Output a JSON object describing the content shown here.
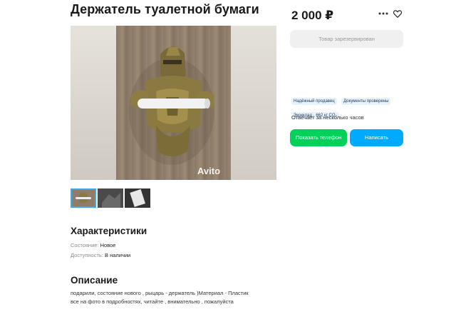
{
  "listing": {
    "title": "Держатель туалетной бумаги",
    "price": "2 000 ₽",
    "reserved_label": "Товар зарезервирован",
    "badges": [
      "Надёжный продавец",
      "Документы проверены",
      "Экокклад · 662 кг CO₂"
    ],
    "response_time": "Отвечает за несколько часов",
    "buttons": {
      "phone": "Показать телефон",
      "write": "Написать"
    },
    "watermark": "Avito"
  },
  "characteristics": {
    "heading": "Характеристики",
    "rows": [
      {
        "label": "Состояние:",
        "value": "Новое"
      },
      {
        "label": "Доступность:",
        "value": "В наличии"
      }
    ]
  },
  "description": {
    "heading": "Описание",
    "lines": [
      "подарили, состояние нового , рыцарь - держатель )Материал - Пластик",
      "все на фото в подробностях, читайте , внимательно , пожалуйста"
    ]
  },
  "icons": [
    "more-dots-icon",
    "heart-icon"
  ],
  "colors": {
    "phone_button": "#02d15c",
    "write_button": "#00aaff",
    "badge_bg": "#e7f2fc",
    "selected_thumb": "#3da9ea"
  }
}
